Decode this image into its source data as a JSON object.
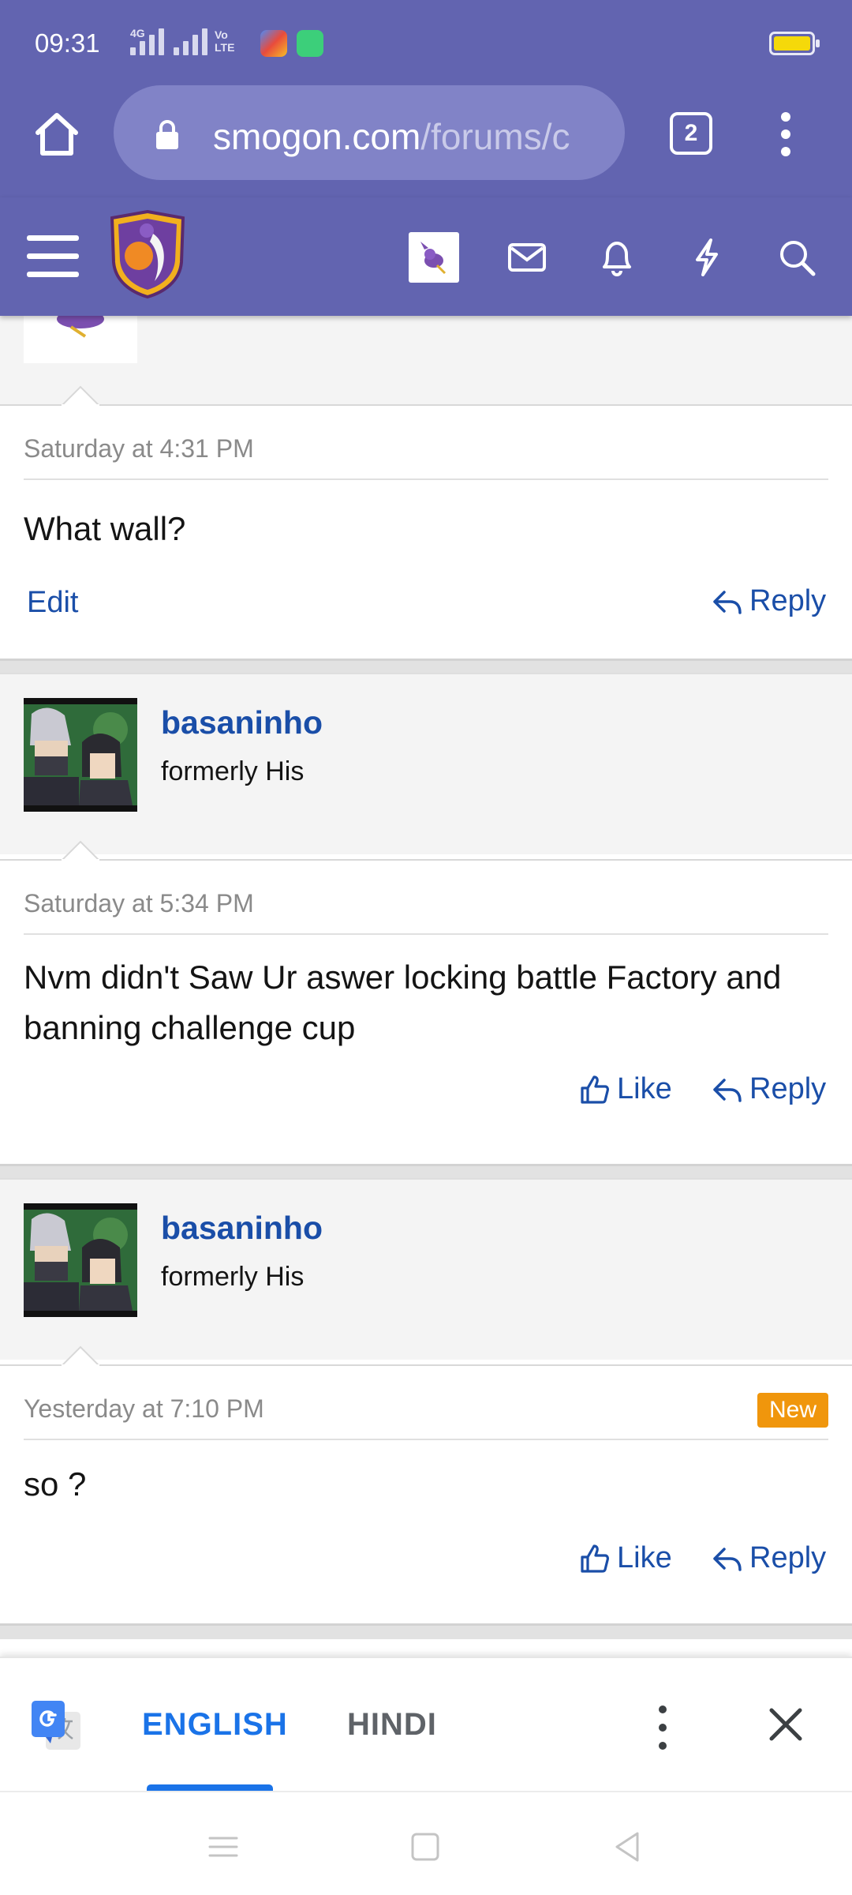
{
  "status_bar": {
    "time": "09:31",
    "network_label": "4G",
    "volte_label": "Vo LTE",
    "colors": {
      "background": "#6264b0",
      "battery": "#f5d90a"
    }
  },
  "browser": {
    "url_main": "smogon.com",
    "url_path": "/forums/c",
    "tab_count": "2"
  },
  "forum_nav": {
    "icons": [
      "menu-icon",
      "smogon-logo",
      "user-avatar",
      "mail-icon",
      "bell-icon",
      "lightning-icon",
      "search-icon"
    ]
  },
  "posts": [
    {
      "date": "Saturday at 4:31 PM",
      "text": "What wall?",
      "actions": {
        "edit": "Edit",
        "reply": "Reply"
      }
    },
    {
      "username": "basaninho",
      "user_title": "formerly His",
      "date": "Saturday at 5:34 PM",
      "text": "Nvm didn't Saw Ur aswer locking battle Factory and banning challenge cup",
      "actions": {
        "like": "Like",
        "reply": "Reply"
      }
    },
    {
      "username": "basaninho",
      "user_title": "formerly His",
      "date": "Yesterday at 7:10 PM",
      "badge": "New",
      "text": "so ?",
      "actions": {
        "like": "Like",
        "reply": "Reply"
      }
    }
  ],
  "translate_bar": {
    "lang_active": "ENGLISH",
    "lang_inactive": "HINDI"
  },
  "colors": {
    "link": "#1a4ea8",
    "translate_accent": "#1a73e8",
    "new_badge": "#f0960c"
  }
}
